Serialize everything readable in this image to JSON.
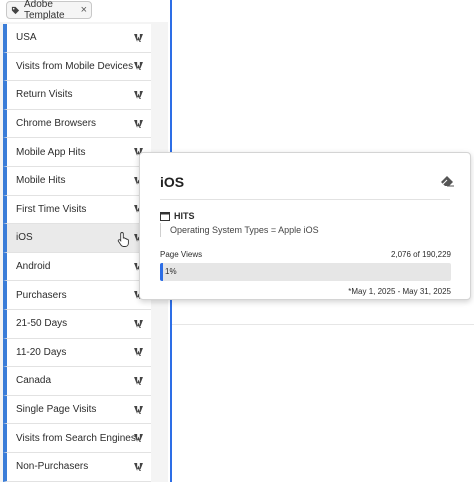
{
  "filter_tag": {
    "label": "Adobe Template",
    "close": "×"
  },
  "segments": [
    {
      "label": "USA"
    },
    {
      "label": "Visits from Mobile Devices"
    },
    {
      "label": "Return Visits"
    },
    {
      "label": "Chrome Browsers"
    },
    {
      "label": "Mobile App Hits"
    },
    {
      "label": "Mobile Hits"
    },
    {
      "label": "First Time Visits"
    },
    {
      "label": "iOS",
      "hovered": true
    },
    {
      "label": "Android"
    },
    {
      "label": "Purchasers"
    },
    {
      "label": "21-50 Days"
    },
    {
      "label": "11-20 Days"
    },
    {
      "label": "Canada"
    },
    {
      "label": "Single Page Visits"
    },
    {
      "label": "Visits from Search Engines"
    },
    {
      "label": "Non-Purchasers"
    }
  ],
  "popover": {
    "title": "iOS",
    "container": "HITS",
    "rule": "Operating System Types = Apple iOS",
    "metric_label": "Page Views",
    "metric_value": "2,076 of 190,229",
    "bar_percent": 1,
    "bar_label": "1%",
    "date_range": "*May 1, 2025 - May 31, 2025"
  },
  "colors": {
    "accent": "#2d6ee6",
    "row_marker": "#3b7dd8"
  },
  "icons": {
    "row": "adobe-logo-icon",
    "popover_action": "eraser-icon",
    "container": "hits-container-icon",
    "tag": "tag-icon",
    "cursor": "hand-cursor-icon"
  }
}
